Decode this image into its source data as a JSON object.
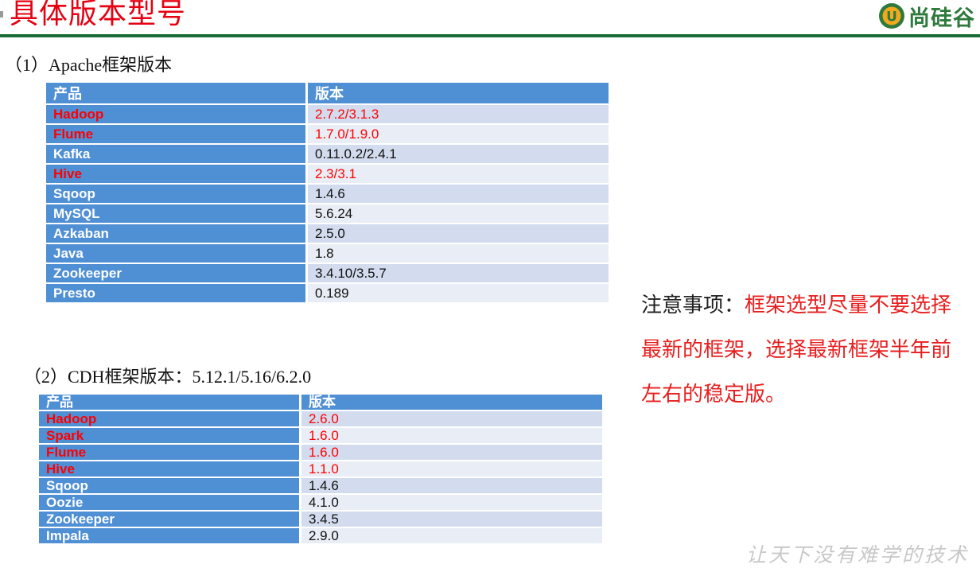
{
  "header": {
    "title": "具体版本型号",
    "logo_text": "尚硅谷",
    "logo_mark_letter": "U",
    "accent_color": "#e60012",
    "rule_color": "#1a6b35"
  },
  "section1": {
    "heading": "（1）Apache框架版本",
    "columns": [
      "产品",
      "版本"
    ],
    "rows": [
      {
        "product": "Hadoop",
        "version": "2.7.2/3.1.3",
        "highlight": true
      },
      {
        "product": "Flume",
        "version": "1.7.0/1.9.0",
        "highlight": true
      },
      {
        "product": "Kafka",
        "version": "0.11.0.2/2.4.1",
        "highlight": false
      },
      {
        "product": "Hive",
        "version": "2.3/3.1",
        "highlight": true
      },
      {
        "product": "Sqoop",
        "version": "1.4.6",
        "highlight": false
      },
      {
        "product": "MySQL",
        "version": "5.6.24",
        "highlight": false
      },
      {
        "product": "Azkaban",
        "version": "2.5.0",
        "highlight": false
      },
      {
        "product": "Java",
        "version": "1.8",
        "highlight": false
      },
      {
        "product": "Zookeeper",
        "version": "3.4.10/3.5.7",
        "highlight": false
      },
      {
        "product": "Presto",
        "version": "0.189",
        "highlight": false
      }
    ]
  },
  "section2": {
    "heading": "（2）CDH框架版本：5.12.1/5.16/6.2.0",
    "columns": [
      "产品",
      "版本"
    ],
    "rows": [
      {
        "product": "Hadoop",
        "version": "2.6.0",
        "highlight": true
      },
      {
        "product": "Spark",
        "version": "1.6.0",
        "highlight": true
      },
      {
        "product": "Flume",
        "version": "1.6.0",
        "highlight": true
      },
      {
        "product": "Hive",
        "version": "1.1.0",
        "highlight": true
      },
      {
        "product": "Sqoop",
        "version": "1.4.6",
        "highlight": false
      },
      {
        "product": "Oozie",
        "version": "4.1.0",
        "highlight": false
      },
      {
        "product": "Zookeeper",
        "version": "3.4.5",
        "highlight": false
      },
      {
        "product": "Impala",
        "version": "2.9.0",
        "highlight": false
      }
    ]
  },
  "note": {
    "prefix": "注意事项：",
    "highlight": "框架选型尽量不要选择最新的框架，选择最新框架半年前左右的稳定版。"
  },
  "slogan": "让天下没有难学的技术",
  "colors": {
    "table_header": "#4f8fd4",
    "row_odd": "#d2dcee",
    "row_even": "#e9edf5",
    "highlight_red": "#ff0000"
  }
}
